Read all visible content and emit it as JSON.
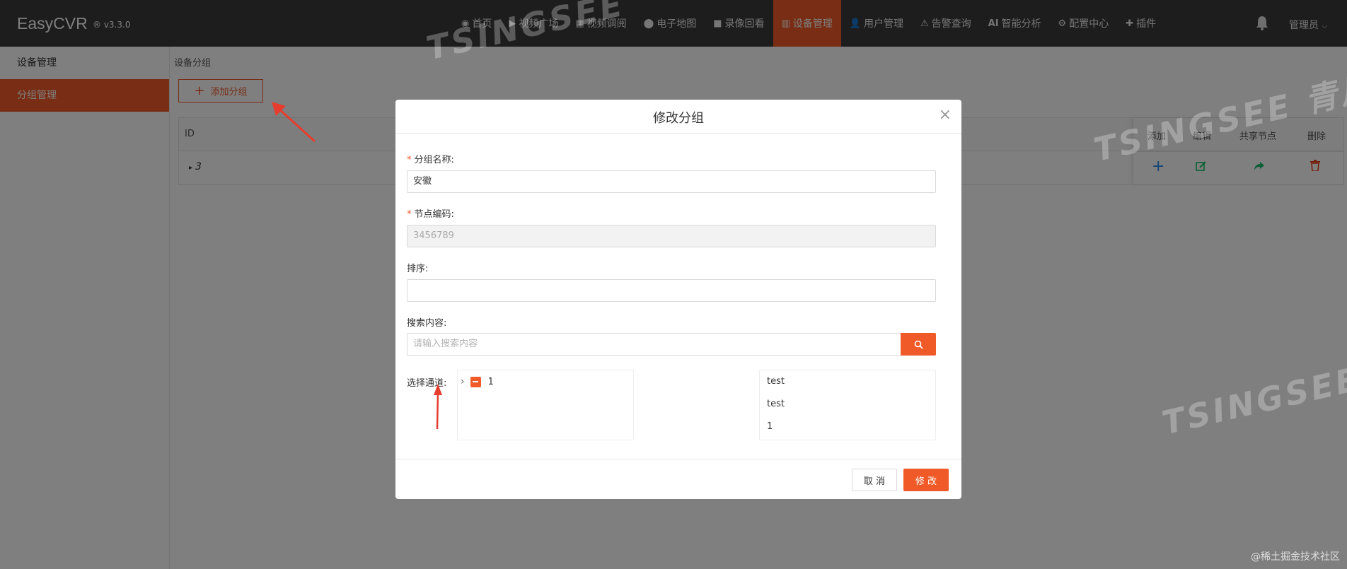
{
  "app": {
    "brand": "EasyCVR",
    "version": "® v3.3.0"
  },
  "nav": [
    {
      "icon": "dashboard-icon",
      "glyph": "◉",
      "label": "首页"
    },
    {
      "icon": "play-circle-icon",
      "glyph": "▶",
      "label": "视频广场"
    },
    {
      "icon": "table-icon",
      "glyph": "▦",
      "label": "视频调阅"
    },
    {
      "icon": "map-marker-icon",
      "glyph": "⬤",
      "label": "电子地图"
    },
    {
      "icon": "video-camera-icon",
      "glyph": "■",
      "label": "录像回看"
    },
    {
      "icon": "columns-icon",
      "glyph": "▥",
      "label": "设备管理"
    },
    {
      "icon": "user-icon",
      "glyph": "👤",
      "label": "用户管理"
    },
    {
      "icon": "alarm-icon",
      "glyph": "⚠",
      "label": "告警查询"
    },
    {
      "icon": "ai-icon",
      "glyph": "AI",
      "label": "智能分析"
    },
    {
      "icon": "gear-icon",
      "glyph": "⚙",
      "label": "配置中心"
    },
    {
      "icon": "puzzle-icon",
      "glyph": "✚",
      "label": "插件"
    }
  ],
  "nav_active": "设备管理",
  "user": {
    "label": "管理员"
  },
  "sidebar": {
    "items": [
      {
        "label": "设备管理"
      },
      {
        "label": "分组管理"
      }
    ]
  },
  "breadcrumb": "设备分组",
  "add_group_button": "添加分组",
  "table": {
    "headers": {
      "id": "ID",
      "add": "添加",
      "edit": "编辑",
      "share": "共享节点",
      "delete": "删除"
    },
    "rows": [
      {
        "id": "3"
      }
    ]
  },
  "modal": {
    "title": "修改分组",
    "group_name": {
      "label": "分组名称:",
      "value": "安徽"
    },
    "node_code": {
      "label": "节点编码:",
      "value": "3456789"
    },
    "sort": {
      "label": "排序:",
      "value": ""
    },
    "search": {
      "label": "搜索内容:",
      "placeholder": "请输入搜索内容"
    },
    "channel_label": "选择通道:",
    "tree": [
      {
        "label": "1"
      }
    ],
    "selected": [
      {
        "label": "test"
      },
      {
        "label": "test"
      },
      {
        "label": "1"
      }
    ],
    "cancel": "取 消",
    "confirm": "修 改"
  },
  "watermarks": [
    "TSINGSEE 青犀视频",
    "TSINGSEE"
  ],
  "corner_mark": "@稀土掘金技术社区",
  "colors": {
    "accent": "#f05a28",
    "topbar": "#3a3a3a",
    "add_icon": "#2d8cf0",
    "edit_icon": "#19be6b",
    "share_icon": "#19be6b",
    "delete_icon": "#ed4014"
  }
}
